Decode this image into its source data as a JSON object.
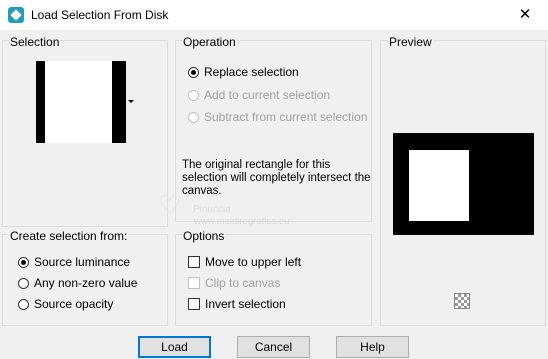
{
  "window": {
    "title": "Load Selection From Disk",
    "close_glyph": "✕"
  },
  "selection": {
    "title": "Selection"
  },
  "operation": {
    "title": "Operation",
    "options": [
      {
        "label": "Replace selection",
        "checked": true,
        "enabled": true
      },
      {
        "label": "Add to current selection",
        "checked": false,
        "enabled": false
      },
      {
        "label": "Subtract from current selection",
        "checked": false,
        "enabled": false
      }
    ],
    "description": "The original rectangle for this selection will completely intersect the canvas."
  },
  "preview": {
    "title": "Preview"
  },
  "create_from": {
    "title": "Create selection from:",
    "options": [
      {
        "label": "Source luminance",
        "checked": true
      },
      {
        "label": "Any non-zero value",
        "checked": false
      },
      {
        "label": "Source opacity",
        "checked": false
      }
    ]
  },
  "options": {
    "title": "Options",
    "items": [
      {
        "label": "Move to upper left",
        "checked": false,
        "enabled": true
      },
      {
        "label": "Clip to canvas",
        "checked": false,
        "enabled": false
      },
      {
        "label": "Invert selection",
        "checked": false,
        "enabled": true
      }
    ]
  },
  "buttons": {
    "load": "Load",
    "cancel": "Cancel",
    "help": "Help"
  },
  "watermark": {
    "line1": "Pinuccia",
    "line2": "www.maidiregrafica.eu"
  },
  "icons": {
    "app": "paintshop-icon",
    "preview_toggle": "checkerboard-icon"
  },
  "colors": {
    "accent": "#0078d7",
    "app_icon": "#1e9cc4"
  }
}
